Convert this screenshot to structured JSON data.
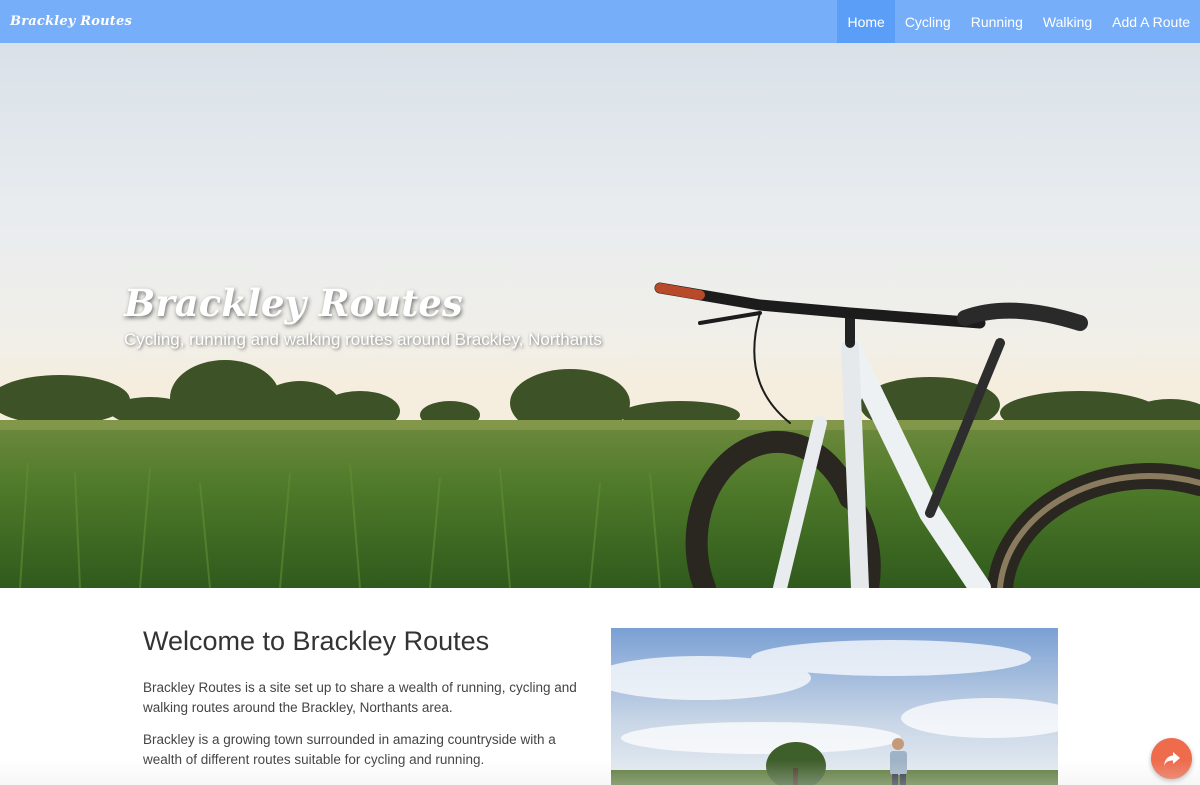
{
  "navbar": {
    "brand": "Brackley Routes",
    "items": [
      {
        "label": "Home",
        "active": true
      },
      {
        "label": "Cycling",
        "active": false
      },
      {
        "label": "Running",
        "active": false
      },
      {
        "label": "Walking",
        "active": false
      },
      {
        "label": "Add A Route",
        "active": false
      }
    ]
  },
  "hero": {
    "title": "Brackley Routes",
    "subtitle": "Cycling, running and walking routes around Brackley, Northants"
  },
  "welcome": {
    "title": "Welcome to Brackley Routes",
    "paragraphs": [
      "Brackley Routes is a site set up to share a wealth of running, cycling and walking routes around the Brackley, Northants area.",
      "Brackley is a growing town surrounded in amazing countryside with a wealth of different routes suitable for cycling and running."
    ]
  },
  "share_button": {
    "icon": "share-arrow-icon"
  },
  "colors": {
    "navbar": "#76aefa",
    "navbar_active": "#5b9ef7",
    "share_button": "#ee6b4c"
  }
}
